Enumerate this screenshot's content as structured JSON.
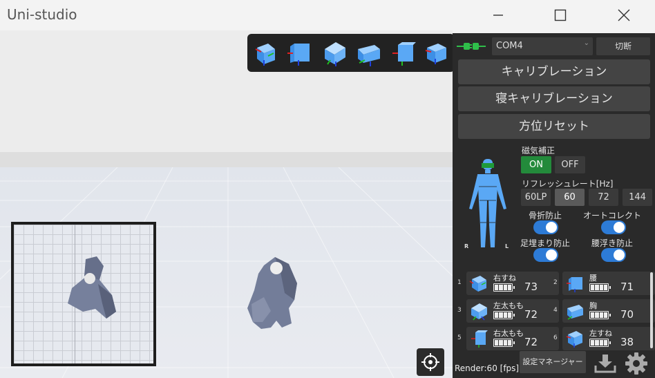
{
  "window": {
    "title": "Uni-studio"
  },
  "connection": {
    "port": "COM4",
    "disconnect_label": "切断"
  },
  "buttons": {
    "calibration": "キャリブレーション",
    "sleep_calibration": "寝キャリブレーション",
    "reset_orientation": "方位リセット"
  },
  "magnetic": {
    "label": "磁気補正",
    "on": "ON",
    "off": "OFF",
    "selected": "ON"
  },
  "refresh": {
    "label": "リフレッシュレート[Hz]",
    "options": [
      "60LP",
      "60",
      "72",
      "144"
    ],
    "selected": "60"
  },
  "toggles": [
    {
      "label": "骨折防止",
      "on": true
    },
    {
      "label": "オートコレクト",
      "on": true
    },
    {
      "label": "足埋まり防止",
      "on": true
    },
    {
      "label": "腰浮き防止",
      "on": true
    }
  ],
  "body_sides": {
    "right": "R",
    "left": "L"
  },
  "sensors": [
    {
      "index": "1",
      "name": "右すね",
      "battery": "73"
    },
    {
      "index": "2",
      "name": "腰",
      "battery": "71"
    },
    {
      "index": "3",
      "name": "左太もも",
      "battery": "72"
    },
    {
      "index": "4",
      "name": "胸",
      "battery": "70"
    },
    {
      "index": "5",
      "name": "右太もも",
      "battery": "72"
    },
    {
      "index": "6",
      "name": "左すね",
      "battery": "38"
    }
  ],
  "footer": {
    "render": "Render:60 [fps]",
    "settings_manager": "設定マネージャー"
  },
  "colors": {
    "accent_blue": "#2d7bd6",
    "on_green": "#238a3b",
    "panel_bg": "#2a2a2a",
    "connector_green": "#2fbf4a"
  },
  "icons": [
    "connector-icon",
    "cube-view-icon",
    "target-icon",
    "download-icon",
    "gear-icon",
    "battery-icon"
  ]
}
